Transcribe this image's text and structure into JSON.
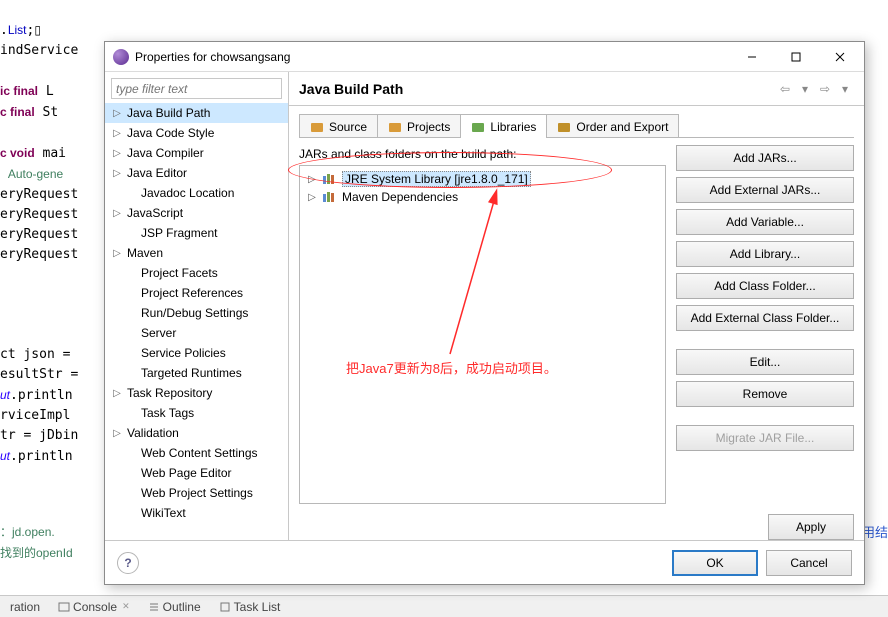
{
  "background": {
    "lines": [
      ".List;▯",
      "indService",
      "",
      "ic final L",
      "c final St",
      "",
      "c void mai",
      " Auto-gene",
      "eryRequest",
      "eryRequest",
      "eryRequest",
      "eryRequest",
      "",
      "",
      "",
      "",
      "ct json = ",
      "esultStr =",
      "ut.println",
      "rviceImpl ",
      "tr = jDbin",
      "ut.println",
      "",
      "：jd.open.",
      "找到的openId"
    ],
    "ext_right": "京东调用结"
  },
  "dialog": {
    "title": "Properties for chowsangsang",
    "filter_placeholder": "type filter text",
    "page_title": "Java Build Path",
    "nav": [
      {
        "label": "Java Build Path",
        "expandable": true,
        "selected": true
      },
      {
        "label": "Java Code Style",
        "expandable": true
      },
      {
        "label": "Java Compiler",
        "expandable": true
      },
      {
        "label": "Java Editor",
        "expandable": true
      },
      {
        "label": "Javadoc Location",
        "leaf": true
      },
      {
        "label": "JavaScript",
        "expandable": true
      },
      {
        "label": "JSP Fragment",
        "leaf": true
      },
      {
        "label": "Maven",
        "expandable": true
      },
      {
        "label": "Project Facets",
        "leaf": true
      },
      {
        "label": "Project References",
        "leaf": true
      },
      {
        "label": "Run/Debug Settings",
        "leaf": true
      },
      {
        "label": "Server",
        "leaf": true
      },
      {
        "label": "Service Policies",
        "leaf": true
      },
      {
        "label": "Targeted Runtimes",
        "leaf": true
      },
      {
        "label": "Task Repository",
        "expandable": true
      },
      {
        "label": "Task Tags",
        "leaf": true
      },
      {
        "label": "Validation",
        "expandable": true
      },
      {
        "label": "Web Content Settings",
        "leaf": true
      },
      {
        "label": "Web Page Editor",
        "leaf": true
      },
      {
        "label": "Web Project Settings",
        "leaf": true
      },
      {
        "label": "WikiText",
        "leaf": true
      }
    ],
    "tabs": [
      {
        "label": "Source"
      },
      {
        "label": "Projects"
      },
      {
        "label": "Libraries",
        "active": true
      },
      {
        "label": "Order and Export"
      }
    ],
    "tree_label": "JARs and class folders on the build path:",
    "tree": [
      {
        "label": "JRE System Library [jre1.8.0_171]",
        "selected": true
      },
      {
        "label": "Maven Dependencies"
      }
    ],
    "buttons": [
      "Add JARs...",
      "Add External JARs...",
      "Add Variable...",
      "Add Library...",
      "Add Class Folder...",
      "Add External Class Folder..."
    ],
    "buttons2": [
      "Edit...",
      "Remove"
    ],
    "buttons3": [
      "Migrate JAR File..."
    ],
    "apply": "Apply",
    "ok": "OK",
    "cancel": "Cancel"
  },
  "annotation": "把Java7更新为8后，成功启动项目。",
  "views": {
    "ration": "ration",
    "console": "Console",
    "outline": "Outline",
    "tasklist": "Task List"
  }
}
